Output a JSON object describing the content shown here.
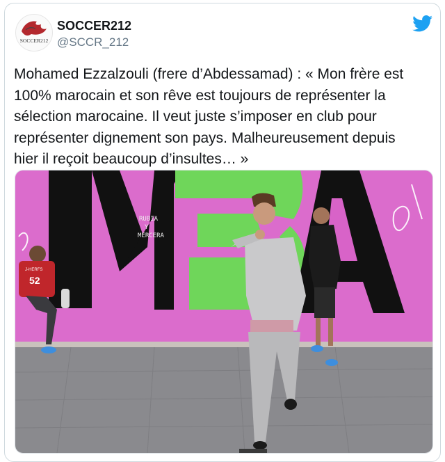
{
  "tweet": {
    "display_name": "SOCCER212",
    "handle": "@SCCR_212",
    "avatar_logo_text": "SOCCER212",
    "text": "Mohamed Ezzalzouli (frere d’Abdessamad) : « Mon frère est\n100% marocain et son rêve est toujours de représenter la\nsélection marocaine. Il veut juste s’imposer en club pour\nreprésenter dignement son pays. Malheureusement depuis\nhier il reçoit beaucoup d’insultes… »"
  },
  "media": {
    "wall_letters": "MEA",
    "graffiti": [
      "RUBIA",
      "Y",
      "MERCERA"
    ],
    "jersey_number": "52",
    "jersey_text": "J-HERFS"
  },
  "icons": {
    "brand": "twitter-bird-icon"
  },
  "colors": {
    "twitter_blue": "#1da1f2",
    "wall_pink": "#d863c8",
    "graffiti_green": "#6fd65a",
    "letter_black": "#111111",
    "pavement": "#8a8a8e"
  }
}
